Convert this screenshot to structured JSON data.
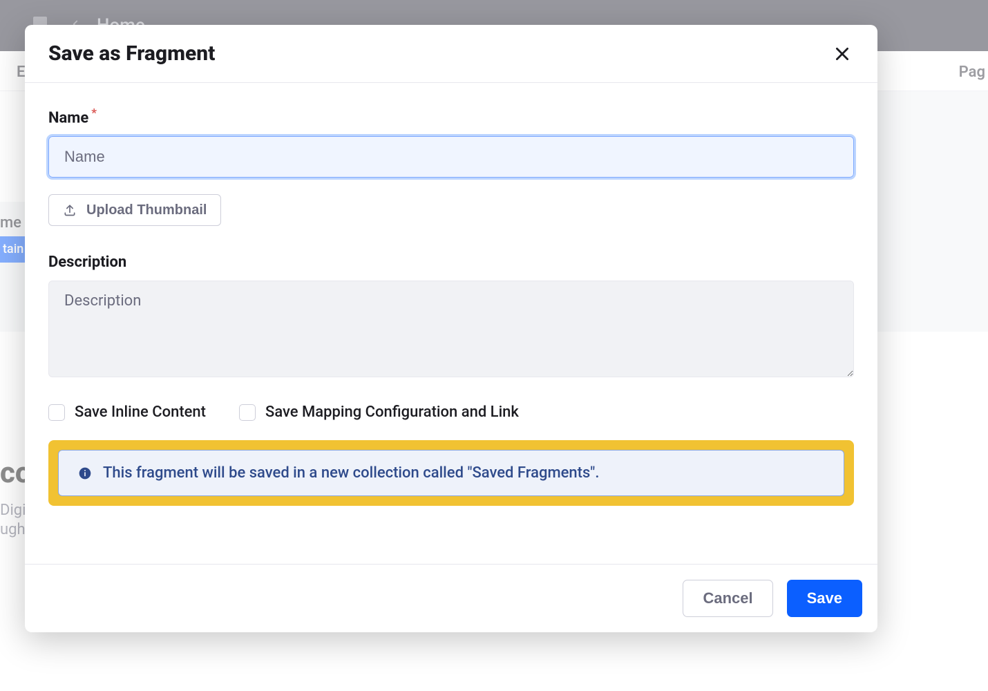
{
  "background": {
    "home_label": "Home",
    "toolbar_left": "E",
    "toolbar_right": "Pag",
    "sidebar_me": "me",
    "sidebar_tag": "tain",
    "hero_co": "co",
    "hero_digit": "Digit",
    "hero_ugh": "ugh"
  },
  "modal": {
    "title": "Save as Fragment",
    "name": {
      "label": "Name",
      "placeholder": "Name",
      "value": ""
    },
    "upload_button": "Upload Thumbnail",
    "description": {
      "label": "Description",
      "placeholder": "Description",
      "value": ""
    },
    "checkboxes": {
      "save_inline": "Save Inline Content",
      "save_mapping": "Save Mapping Configuration and Link"
    },
    "info_message": "This fragment will be saved in a new collection called \"Saved Fragments\".",
    "footer": {
      "cancel": "Cancel",
      "save": "Save"
    }
  }
}
